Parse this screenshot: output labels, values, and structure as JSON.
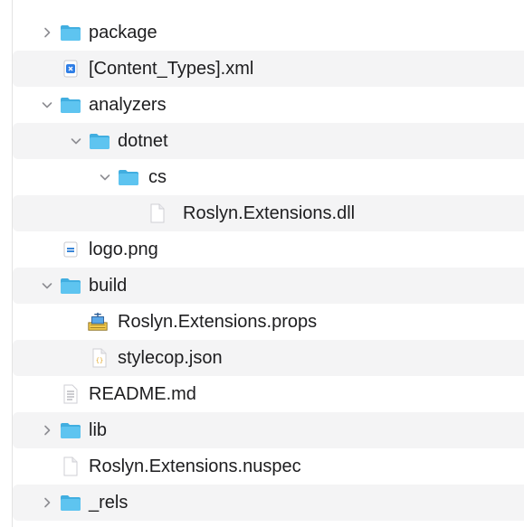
{
  "file_tree": {
    "items": [
      {
        "name": "package",
        "kind": "folder",
        "expanded": false
      },
      {
        "name": "[Content_Types].xml",
        "kind": "xml-file"
      },
      {
        "name": "analyzers",
        "kind": "folder",
        "expanded": true
      },
      {
        "name": "dotnet",
        "kind": "folder",
        "expanded": true
      },
      {
        "name": "cs",
        "kind": "folder",
        "expanded": true
      },
      {
        "name": "Roslyn.Extensions.dll",
        "kind": "generic-file"
      },
      {
        "name": "logo.png",
        "kind": "image-file"
      },
      {
        "name": "build",
        "kind": "folder",
        "expanded": true
      },
      {
        "name": "Roslyn.Extensions.props",
        "kind": "props-file"
      },
      {
        "name": "stylecop.json",
        "kind": "json-file"
      },
      {
        "name": "README.md",
        "kind": "text-file"
      },
      {
        "name": "lib",
        "kind": "folder",
        "expanded": false
      },
      {
        "name": "Roslyn.Extensions.nuspec",
        "kind": "generic-file"
      },
      {
        "name": "_rels",
        "kind": "folder",
        "expanded": false
      }
    ]
  },
  "colors": {
    "folder": "#5ec4f0",
    "folder_tab": "#41aee0",
    "text": "#1d1d1f",
    "disclosure": "#8e8e93",
    "stripe": "#f4f4f5"
  }
}
